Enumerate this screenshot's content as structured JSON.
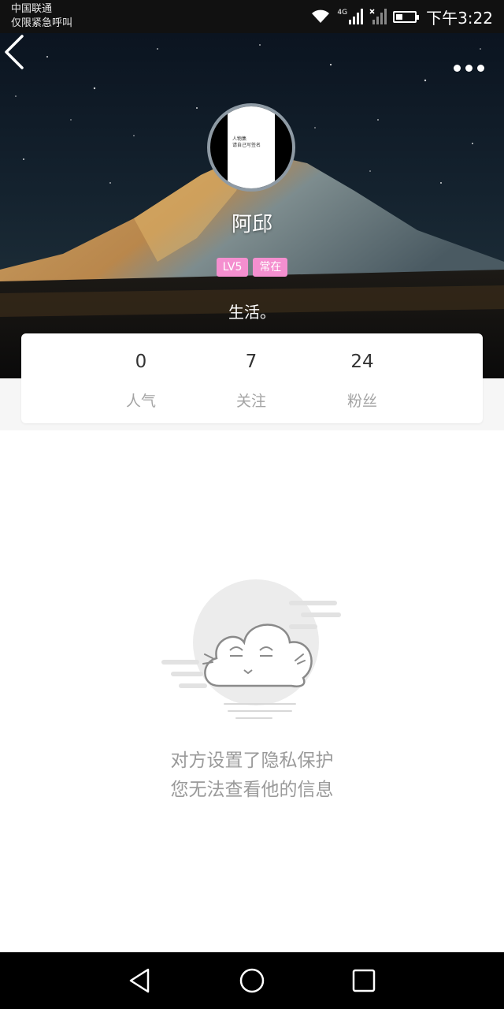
{
  "status_bar": {
    "carrier": "中国联通",
    "emergency": "仅限紧急呼叫",
    "network": "4G",
    "time": "下午3:22",
    "battery_level": 0.35
  },
  "profile": {
    "username": "阿邱",
    "level_badge": "LV5",
    "status_badge": "常在",
    "signature": "生活。",
    "avatar_text": [
      "人物集",
      "请自己写签名"
    ],
    "badge_color": "#f48fcf"
  },
  "stats": [
    {
      "value": "0",
      "label": "人气"
    },
    {
      "value": "7",
      "label": "关注"
    },
    {
      "value": "24",
      "label": "粉丝"
    }
  ],
  "privacy": {
    "line1": "对方设置了隐私保护",
    "line2": "您无法查看他的信息"
  },
  "icons": {
    "back": "chevron-left-icon",
    "more": "more-dots-icon",
    "nav_back": "triangle-back-icon",
    "nav_home": "circle-home-icon",
    "nav_recent": "square-recent-icon"
  }
}
